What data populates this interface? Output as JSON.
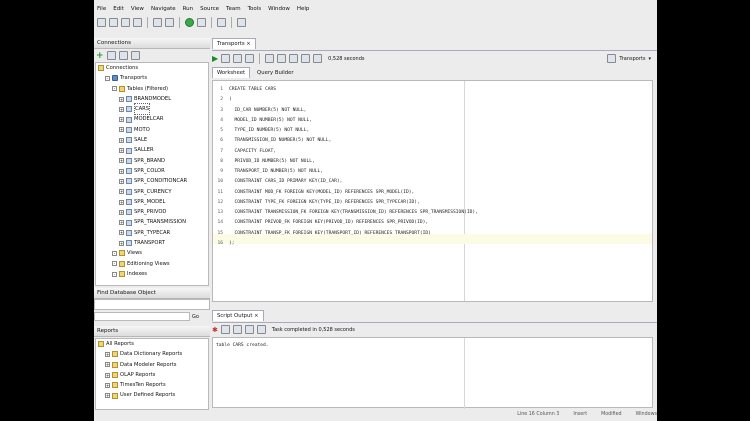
{
  "menu": [
    "File",
    "Edit",
    "View",
    "Navigate",
    "Run",
    "Source",
    "Team",
    "Tools",
    "Window",
    "Help"
  ],
  "connections": {
    "title": "Connections",
    "tree": [
      {
        "label": "Connections",
        "level": 0,
        "icon": "fold"
      },
      {
        "label": "Transports",
        "level": 1,
        "icon": "db"
      },
      {
        "label": "Tables (Filtered)",
        "level": 2,
        "icon": "fold"
      },
      {
        "label": "BRANDMODEL",
        "level": 3,
        "icon": "table"
      },
      {
        "label": "CARS",
        "level": 3,
        "icon": "table"
      },
      {
        "label": "MODELCAR",
        "level": 3,
        "icon": "table"
      },
      {
        "label": "MOTO",
        "level": 3,
        "icon": "table"
      },
      {
        "label": "SALE",
        "level": 3,
        "icon": "table"
      },
      {
        "label": "SALLER",
        "level": 3,
        "icon": "table"
      },
      {
        "label": "SPR_BRAND",
        "level": 3,
        "icon": "table"
      },
      {
        "label": "SPR_COLOR",
        "level": 3,
        "icon": "table"
      },
      {
        "label": "SPR_CONDITIONCAR",
        "level": 3,
        "icon": "table"
      },
      {
        "label": "SPR_CURENCY",
        "level": 3,
        "icon": "table"
      },
      {
        "label": "SPR_MODEL",
        "level": 3,
        "icon": "table"
      },
      {
        "label": "SPR_PRIVOD",
        "level": 3,
        "icon": "table"
      },
      {
        "label": "SPR_TRANSMISSION",
        "level": 3,
        "icon": "table"
      },
      {
        "label": "SPR_TYPECAR",
        "level": 3,
        "icon": "table"
      },
      {
        "label": "TRANSPORT",
        "level": 3,
        "icon": "table"
      },
      {
        "label": "Views",
        "level": 2,
        "icon": "fold"
      },
      {
        "label": "Editioning Views",
        "level": 2,
        "icon": "fold"
      },
      {
        "label": "Indexes",
        "level": 2,
        "icon": "fold"
      }
    ]
  },
  "find_db_object": {
    "title": "Find Database Object",
    "go_label": "Go"
  },
  "reports": {
    "title": "Reports",
    "items": [
      {
        "label": "All Reports",
        "level": 0
      },
      {
        "label": "Data Dictionary Reports",
        "level": 1
      },
      {
        "label": "Data Modeler Reports",
        "level": 1
      },
      {
        "label": "OLAP Reports",
        "level": 1
      },
      {
        "label": "TimesTen Reports",
        "level": 1
      },
      {
        "label": "User Defined Reports",
        "level": 1
      }
    ]
  },
  "editor": {
    "tab": "Transports",
    "timer": "0,528 seconds",
    "connection": "Transports",
    "subtabs": [
      "Worksheet",
      "Query Builder"
    ],
    "lines": [
      "CREATE TABLE CARS",
      "(",
      "  ID_CAR NUMBER(5) NOT NULL,",
      "  MODEL_ID NUMBER(5) NOT NULL,",
      "  TYPE_ID NUMBER(5) NOT NULL,",
      "  TRANSMISSION_ID NUMBER(5) NOT NULL,",
      "  CAPACITY FLOAT,",
      "  PRIVOD_ID NUMBER(5) NOT NULL,",
      "  TRANSPORT_ID NUMBER(5) NOT NULL,",
      "  CONSTRAINT CARS_ID PRIMARY KEY(ID_CAR),",
      "  CONSTRAINT MOD_FK FOREIGN KEY(MODEL_ID) REFERENCES SPR_MODEL(ID),",
      "  CONSTRAINT TYPE_FK FOREIGN KEY(TYPE_ID) REFERENCES SPR_TYPECAR(ID),",
      "  CONSTRAINT TRANSMISSION_FK FOREIGN KEY(TRANSMISSION_ID) REFERENCES SPR_TRANSMISSION(ID),",
      "  CONSTRAINT PRIVOD_FK FOREIGN KEY(PRIVOD_ID) REFERENCES SPR_PRIVOD(ID),",
      "  CONSTRAINT TRANSP_FK FOREIGN KEY(TRANSPORT_ID) REFERENCES TRANSPORT(ID)",
      ");"
    ]
  },
  "script_output": {
    "tab": "Script Output",
    "status": "Task completed in 0,528 seconds",
    "text": "table CARS created."
  },
  "statusbar": {
    "position": "Line 16 Column 3",
    "mode": "Insert",
    "modified": "Modified",
    "os": "Windows"
  }
}
